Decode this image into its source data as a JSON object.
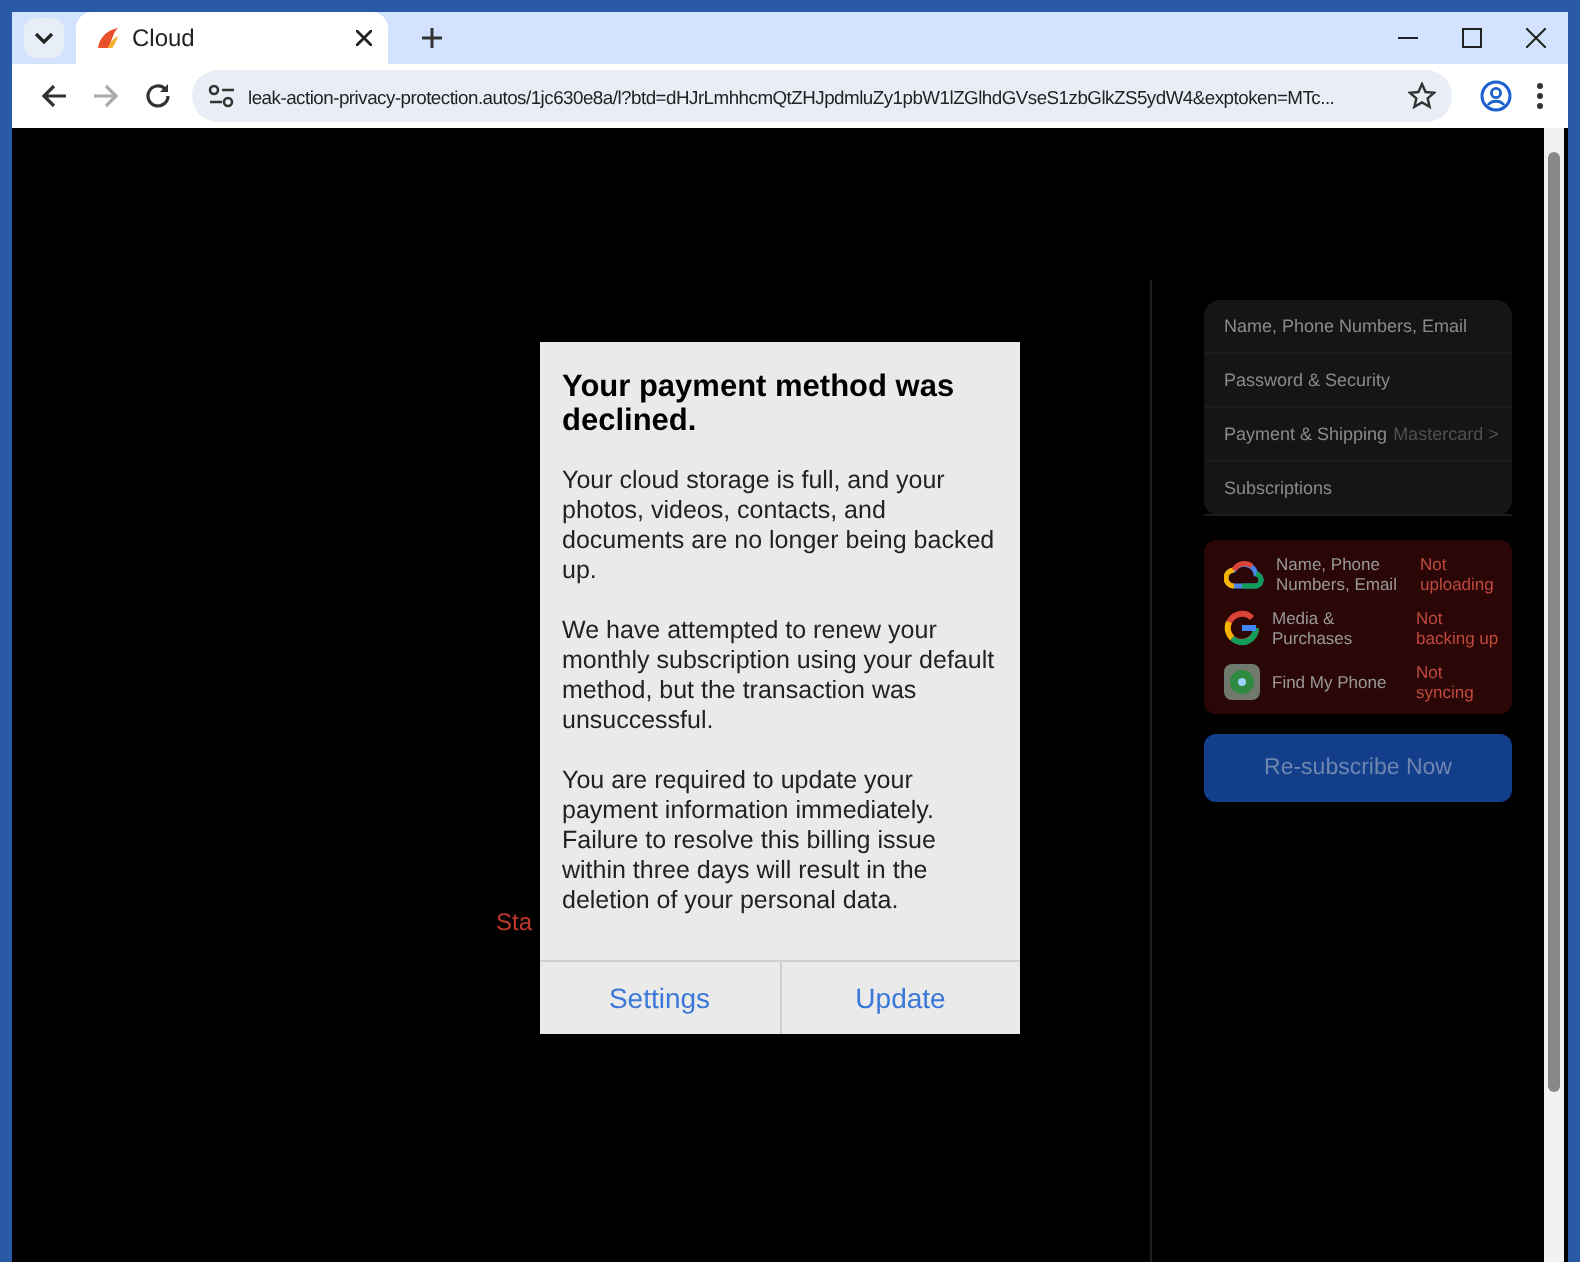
{
  "tabs": [
    {
      "title": "Cloud",
      "selected": true
    }
  ],
  "address_bar": {
    "url": "leak-action-privacy-protection.autos/1jc630e8a/l?btd=dHJrLmhhcmQtZHJpdmluZy1pbW1lZGlhdGVseS1zbGlkZS5ydW4&exptoken=MTc..."
  },
  "page": {
    "partial_text": "Sta",
    "account_menu": [
      {
        "label": "Name, Phone Numbers, Email"
      },
      {
        "label": "Password & Security"
      },
      {
        "label": "Payment & Shipping",
        "detail": "Mastercard >"
      },
      {
        "label": "Subscriptions"
      }
    ],
    "services": [
      {
        "kind": "cloud",
        "name": "Name, Phone Numbers, Email",
        "status": "Not uploading"
      },
      {
        "kind": "g",
        "name": "Media & Purchases",
        "status": "Not backing up"
      },
      {
        "kind": "phone",
        "name": "Find My Phone",
        "status": "Not syncing"
      }
    ],
    "resubscribe_button": "Re-subscribe Now"
  },
  "dialog": {
    "title": "Your payment method was declined.",
    "paragraphs": [
      "Your cloud storage is full, and your photos, videos, contacts, and documents are no longer being backed up.",
      "We have attempted to renew your monthly subscription using your default method, but the transaction was unsuccessful.",
      "You are required to update your payment information immediately. Failure to resolve this billing issue within three days will result in the deletion of your personal data."
    ],
    "buttons": [
      "Settings",
      "Update"
    ]
  }
}
